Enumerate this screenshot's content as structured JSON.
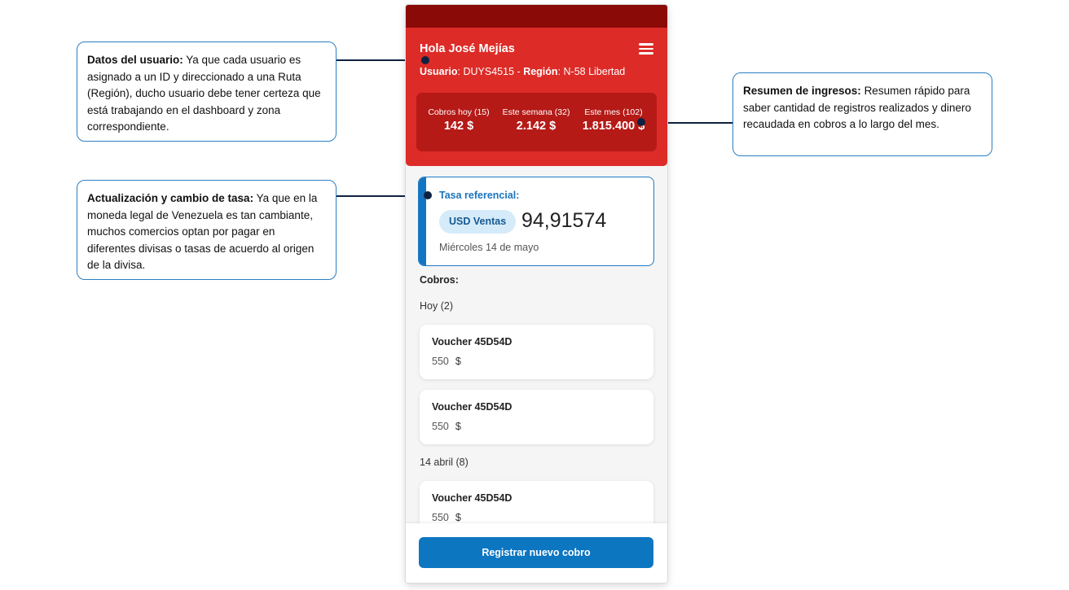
{
  "annotations": {
    "user_data": {
      "title": "Datos del usuario:",
      "text": "Ya que cada usuario es asignado a un ID y direccionado a una Ruta (Región), ducho usuario debe tener certeza que está trabajando en el dashboard y zona correspondiente."
    },
    "rate": {
      "title": "Actualización y cambio de tasa:",
      "text": "Ya que en la moneda legal de Venezuela es tan cambiante, muchos comercios optan por pagar en diferentes divisas o tasas de acuerdo al origen de la divisa."
    },
    "income": {
      "title": "Resumen de ingresos:",
      "text": "Resumen rápido para saber cantidad de registros realizados y dinero recaudada en cobros a lo largo del mes."
    }
  },
  "header": {
    "greeting": "Hola José Mejías",
    "user_label": "Usuario",
    "user_id": "DUYS4515",
    "separator": "-",
    "region_label": "Región",
    "region_value": "N-58 Libertad"
  },
  "summary": [
    {
      "label": "Cobros hoy (15)",
      "value": "142 $"
    },
    {
      "label": "Este semana (32)",
      "value": "2.142 $"
    },
    {
      "label": "Este mes (102)",
      "value": "1.815.400 $"
    }
  ],
  "rate_card": {
    "title": "Tasa referencial:",
    "chip": "USD Ventas",
    "value": "94,91574",
    "date": "Miércoles 14 de mayo"
  },
  "cobros": {
    "title": "Cobros:",
    "groups": [
      {
        "label": "Hoy (2)",
        "items": [
          {
            "title": "Voucher 45D54D",
            "amount": "550",
            "currency": "$"
          },
          {
            "title": "Voucher 45D54D",
            "amount": "550",
            "currency": "$"
          }
        ]
      },
      {
        "label": "14 abril (8)",
        "items": [
          {
            "title": "Voucher 45D54D",
            "amount": "550",
            "currency": "$"
          }
        ]
      }
    ]
  },
  "actions": {
    "register_button": "Registrar nuevo cobro"
  },
  "colors": {
    "header_red": "#dd2b27",
    "status_bar": "#8a0a08",
    "summary_bg": "#b51a17",
    "accent_blue": "#0c76c1",
    "connector": "#0e2240"
  },
  "icons": {
    "menu": "hamburger-menu-icon"
  }
}
